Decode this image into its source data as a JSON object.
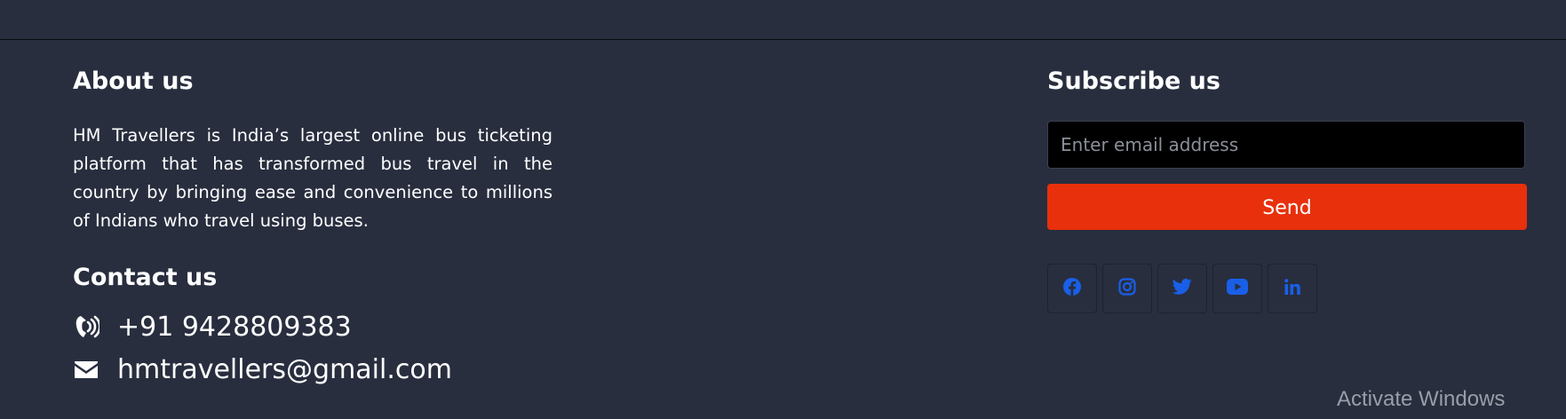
{
  "about": {
    "heading": "About us",
    "text": "HM Travellers is India’s largest online bus ticketing platform that has transformed bus travel in the country by bringing ease and convenience to millions of Indians who travel using buses."
  },
  "contact": {
    "heading": "Contact us",
    "phone": {
      "icon": "phone-volume-icon",
      "value": "+91 9428809383"
    },
    "email": {
      "icon": "envelope-icon",
      "value": "hmtravellers@gmail.com"
    }
  },
  "subscribe": {
    "heading": "Subscribe us",
    "email_placeholder": "Enter email address",
    "email_value": "",
    "send_label": "Send"
  },
  "social": [
    {
      "name": "facebook",
      "icon": "facebook-icon"
    },
    {
      "name": "instagram",
      "icon": "instagram-icon"
    },
    {
      "name": "twitter",
      "icon": "twitter-icon"
    },
    {
      "name": "youtube",
      "icon": "youtube-icon"
    },
    {
      "name": "linkedin",
      "icon": "linkedin-icon"
    }
  ],
  "watermark": "Activate Windows",
  "colors": {
    "background": "#282e3e",
    "accent": "#e8300c",
    "social_icon": "#1a5fe8",
    "text": "#ffffff"
  }
}
